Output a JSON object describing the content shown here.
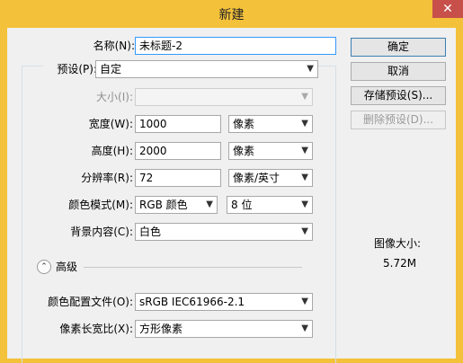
{
  "window": {
    "title": "新建"
  },
  "fields": {
    "name_label": "名称(N):",
    "name_value": "未标题-2",
    "preset_label": "预设(P):",
    "preset_value": "自定",
    "size_label": "大小(I):",
    "size_value": "",
    "width_label": "宽度(W):",
    "width_value": "1000",
    "width_unit": "像素",
    "height_label": "高度(H):",
    "height_value": "2000",
    "height_unit": "像素",
    "resolution_label": "分辨率(R):",
    "resolution_value": "72",
    "resolution_unit": "像素/英寸",
    "color_mode_label": "颜色模式(M):",
    "color_mode_value": "RGB 颜色",
    "bit_depth_value": "8 位",
    "background_label": "背景内容(C):",
    "background_value": "白色",
    "advanced_label": "高级",
    "color_profile_label": "颜色配置文件(O):",
    "color_profile_value": "sRGB IEC61966-2.1",
    "pixel_aspect_label": "像素长宽比(X):",
    "pixel_aspect_value": "方形像素"
  },
  "buttons": {
    "ok": "确定",
    "cancel": "取消",
    "save_preset": "存储预设(S)...",
    "delete_preset": "删除预设(D)..."
  },
  "image_size": {
    "label": "图像大小:",
    "value": "5.72M"
  },
  "icons": {
    "close": "close-icon",
    "dropdown": "chevron-down-icon",
    "collapse": "chevron-up-double-icon"
  }
}
